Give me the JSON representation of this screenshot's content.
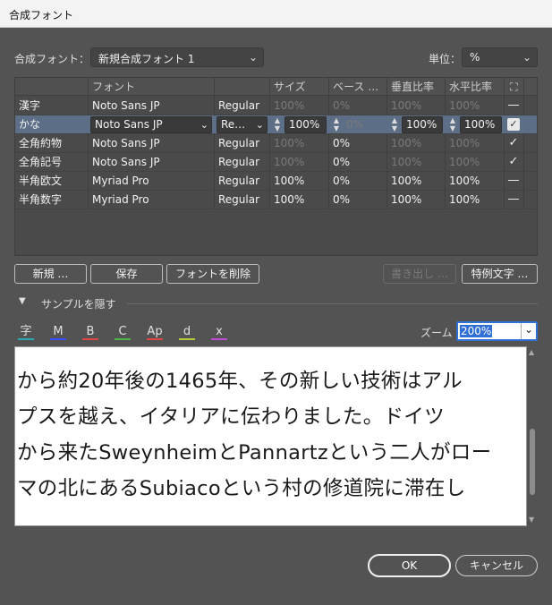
{
  "window": {
    "title": "合成フォント"
  },
  "top": {
    "font_label": "合成フォント：",
    "font_value": "新規合成フォント 1",
    "unit_label": "単位：",
    "unit_value": "%"
  },
  "table": {
    "headers": [
      "フォント",
      "サイズ",
      "ベース …",
      "垂直比率",
      "水平比率"
    ],
    "rows": [
      {
        "name": "漢字",
        "font": "Noto Sans JP",
        "style": "Regular",
        "size": "100%",
        "base": "0%",
        "vscale": "100%",
        "hscale": "100%",
        "mark": "—"
      },
      {
        "name": "かな",
        "font": "Noto Sans JP",
        "style": "Re…",
        "size": "100%",
        "base": "0%",
        "vscale": "100%",
        "hscale": "100%",
        "mark": "✓"
      },
      {
        "name": "全角約物",
        "font": "Noto Sans JP",
        "style": "Regular",
        "size": "100%",
        "base": "0%",
        "vscale": "100%",
        "hscale": "100%",
        "mark": "✓"
      },
      {
        "name": "全角記号",
        "font": "Noto Sans JP",
        "style": "Regular",
        "size": "100%",
        "base": "0%",
        "vscale": "100%",
        "hscale": "100%",
        "mark": "✓"
      },
      {
        "name": "半角欧文",
        "font": "Myriad Pro",
        "style": "Regular",
        "size": "100%",
        "base": "0%",
        "vscale": "100%",
        "hscale": "100%",
        "mark": "—"
      },
      {
        "name": "半角数字",
        "font": "Myriad Pro",
        "style": "Regular",
        "size": "100%",
        "base": "0%",
        "vscale": "100%",
        "hscale": "100%",
        "mark": "—"
      }
    ]
  },
  "buttons": {
    "new": "新規 …",
    "save": "保存",
    "delete_font": "フォントを削除",
    "export": "書き出し …",
    "exception": "特例文字 …"
  },
  "sample": {
    "toggle_label": "サンプルを隠す",
    "tools": [
      "字",
      "M",
      "B",
      "C",
      "Ap",
      "d",
      "x"
    ],
    "tool_colors": [
      "#2aa9b3",
      "#3b4bff",
      "#e04848",
      "#47b547",
      "#e04848",
      "#b9c83a",
      "#c04bd3"
    ],
    "zoom_label": "ズーム",
    "zoom_value": "200%",
    "lines": [
      "から約20年後の1465年、その新しい技術はアル",
      "プスを越え、イタリアに伝わりました。ドイツ",
      "から来たSweynheimとPannartzという二人がロー",
      "マの北にあるSubiacoという村の修道院に滞在し"
    ]
  },
  "footer": {
    "ok": "OK",
    "cancel": "キャンセル"
  }
}
